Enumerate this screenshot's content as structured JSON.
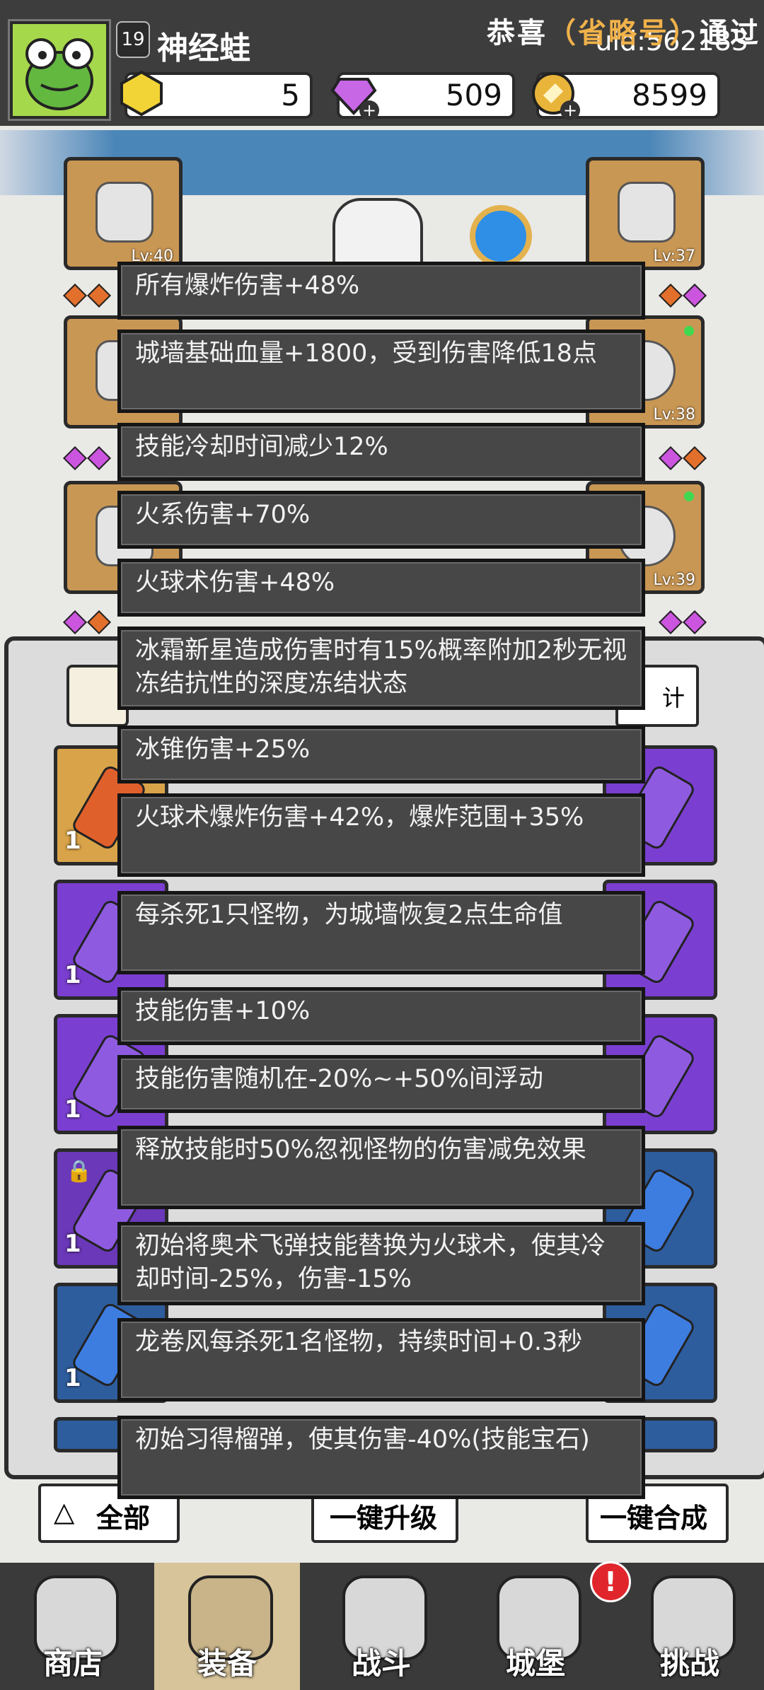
{
  "header": {
    "level": "19",
    "player_name": "神经蛙",
    "uid": "uid:562183",
    "currencies": [
      {
        "name": "gold-crystal",
        "value": "5"
      },
      {
        "name": "purple-gem",
        "value": "509"
      },
      {
        "name": "coin",
        "value": "8599"
      }
    ]
  },
  "banner": {
    "prefix": "恭喜",
    "highlight": "（省略号）",
    "suffix": "通过"
  },
  "equipment_levels": [
    "Lv:40",
    "Lv:37",
    "Lv:38",
    "Lv:39"
  ],
  "panel": {
    "stats_button": "计",
    "gem_counts": [
      "1",
      "1",
      "1",
      "1",
      "1",
      "1"
    ]
  },
  "effects": [
    "所有爆炸伤害+48%",
    "城墙基础血量+1800，受到伤害降低18点",
    "技能冷却时间减少12%",
    "火系伤害+70%",
    "火球术伤害+48%",
    "冰霜新星造成伤害时有15%概率附加2秒无视冻结抗性的深度冻结状态",
    "冰锥伤害+25%",
    "火球术爆炸伤害+42%，爆炸范围+35%",
    "每杀死1只怪物，为城墙恢复2点生命值",
    "技能伤害+10%",
    "技能伤害随机在-20%~+50%间浮动",
    "释放技能时50%忽视怪物的伤害减免效果",
    "初始将奥术飞弹技能替换为火球术，使其冷却时间-25%，伤害-15%",
    "龙卷风每杀死1名怪物，持续时间+0.3秒",
    "初始习得榴弹，使其伤害-40%(技能宝石)"
  ],
  "bottom_buttons": {
    "filter_all": "全部",
    "upgrade_all": "一键升级",
    "merge_all": "一键合成"
  },
  "nav": [
    {
      "label": "商店"
    },
    {
      "label": "装备"
    },
    {
      "label": "战斗"
    },
    {
      "label": "城堡"
    },
    {
      "label": "挑战"
    }
  ],
  "nav_badge": "!"
}
